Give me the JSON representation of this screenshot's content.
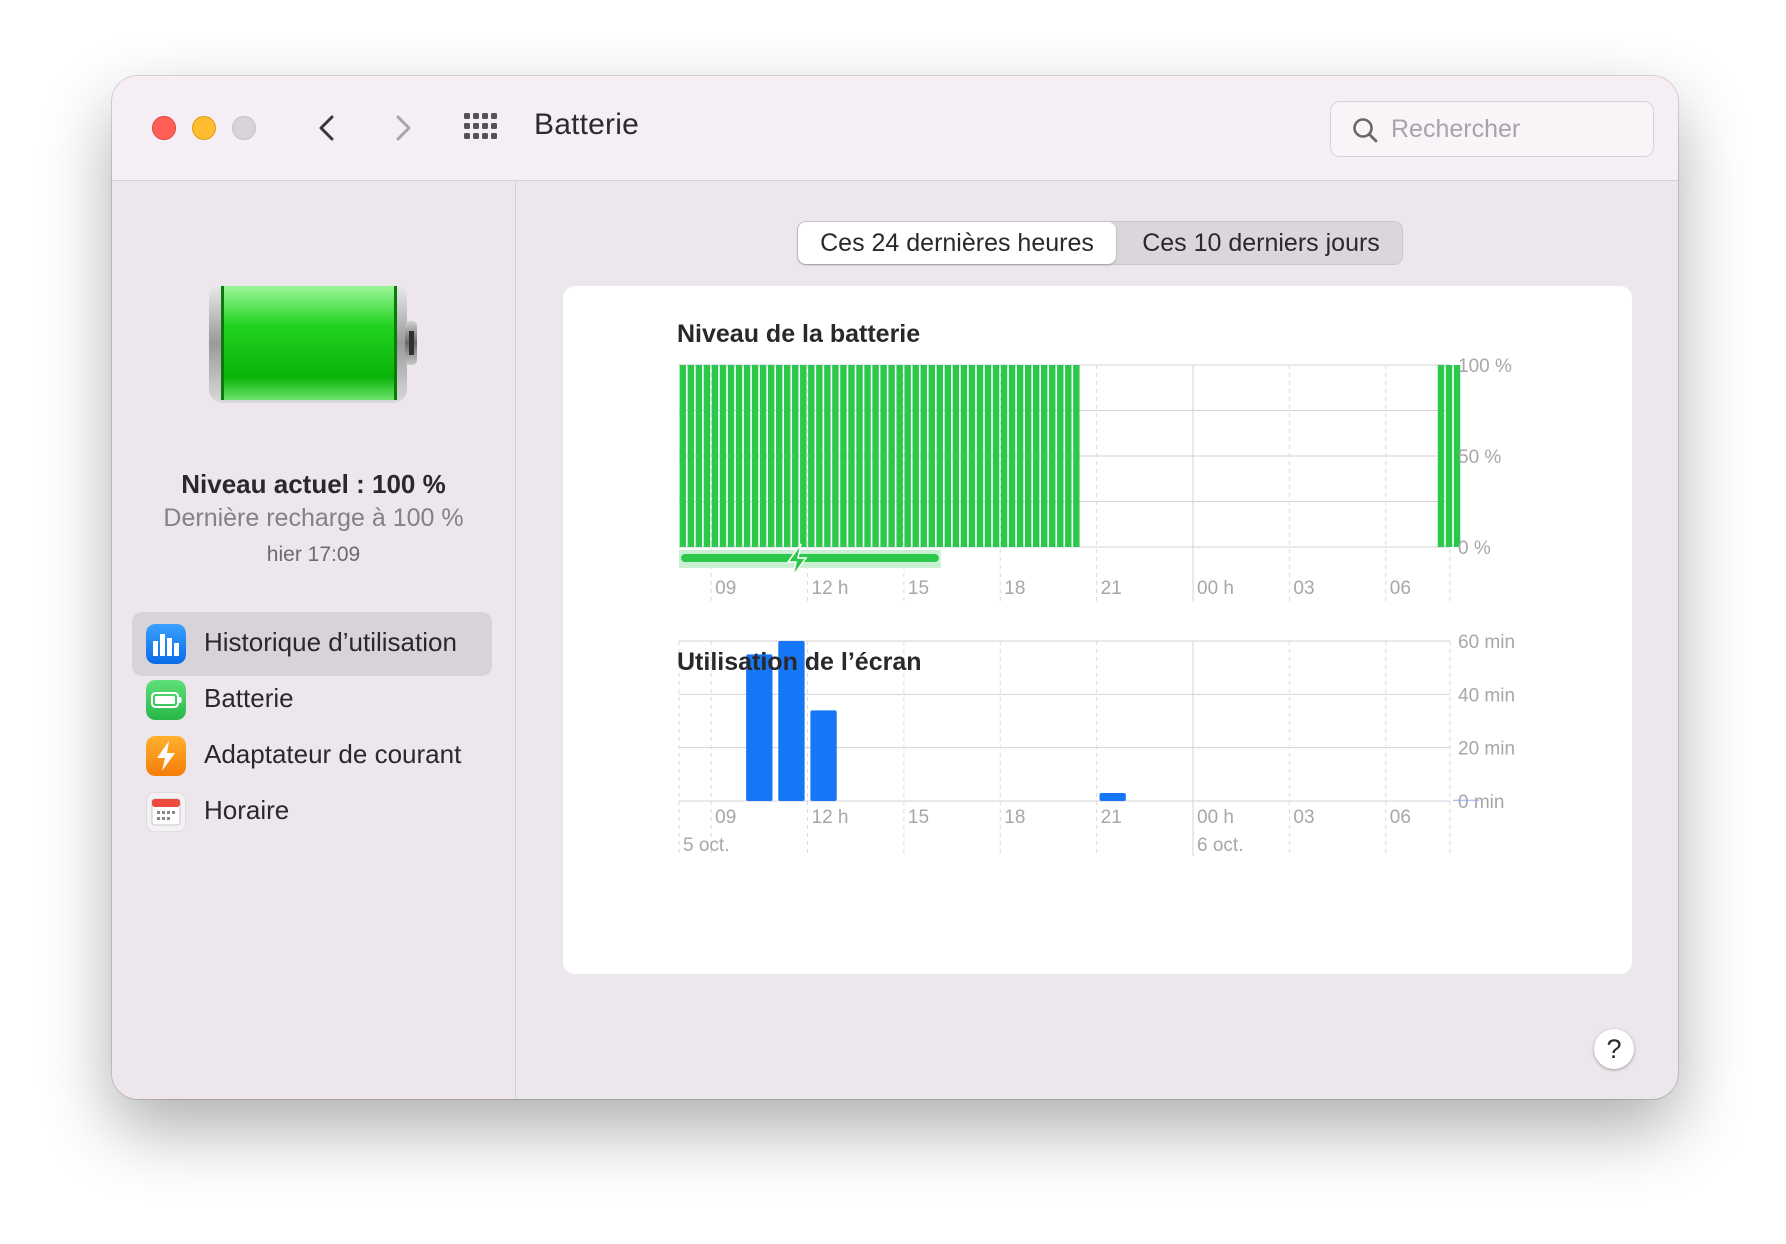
{
  "window": {
    "title": "Batterie",
    "search_placeholder": "Rechercher"
  },
  "sidebar": {
    "level_text": "Niveau actuel : 100 %",
    "recharge_text": "Dernière recharge à 100 %",
    "recharge_time": "hier 17:09",
    "battery_level": 1.0,
    "items": [
      {
        "label": "Historique d’utilisation",
        "icon": "usage-history-icon",
        "selected": true
      },
      {
        "label": "Batterie",
        "icon": "battery-icon",
        "selected": false
      },
      {
        "label": "Adaptateur de courant",
        "icon": "power-adapter-icon",
        "selected": false
      },
      {
        "label": "Horaire",
        "icon": "schedule-calendar-icon",
        "selected": false
      }
    ]
  },
  "tabs": [
    {
      "label": "Ces 24 dernières heures",
      "active": true
    },
    {
      "label": "Ces 10 derniers jours",
      "active": false
    }
  ],
  "help_label": "?",
  "colors": {
    "battery_green": "#2cc84b",
    "screen_blue": "#1677f6",
    "charging_green": "#2cc84b"
  },
  "chart_data": [
    {
      "type": "bar",
      "title": "Niveau de la batterie",
      "x_ticks": [
        "09",
        "12 h",
        "15",
        "18",
        "21",
        "00 h",
        "03",
        "06"
      ],
      "y_ticks": [
        "100 %",
        "50 %",
        "0 %"
      ],
      "ylim": [
        0,
        100
      ],
      "unit": "%",
      "series": [
        {
          "segments": [
            {
              "start_hour": 8.0,
              "end_hour": 20.5,
              "level": 100
            },
            {
              "start_hour": 31.6,
              "end_hour": 32.3,
              "level": 100
            }
          ]
        }
      ],
      "charging": [
        {
          "start_hour": 8.0,
          "end_hour": 16.15
        }
      ]
    },
    {
      "type": "bar",
      "title": "Utilisation de l’écran",
      "x_ticks": [
        "09",
        "12 h",
        "15",
        "18",
        "21",
        "00 h",
        "03",
        "06"
      ],
      "date_labels": [
        {
          "hour": 9,
          "label": "5 oct."
        },
        {
          "hour": 24,
          "label": "6 oct."
        }
      ],
      "y_ticks": [
        "60 min",
        "40 min",
        "20 min",
        "0 min"
      ],
      "ylim": [
        0,
        60
      ],
      "unit": "min",
      "bars": [
        {
          "hour": 10,
          "value": 55
        },
        {
          "hour": 11,
          "value": 60
        },
        {
          "hour": 12,
          "value": 34
        },
        {
          "hour": 21,
          "value": 3
        },
        {
          "hour": 32,
          "value": 0.5
        }
      ]
    }
  ]
}
